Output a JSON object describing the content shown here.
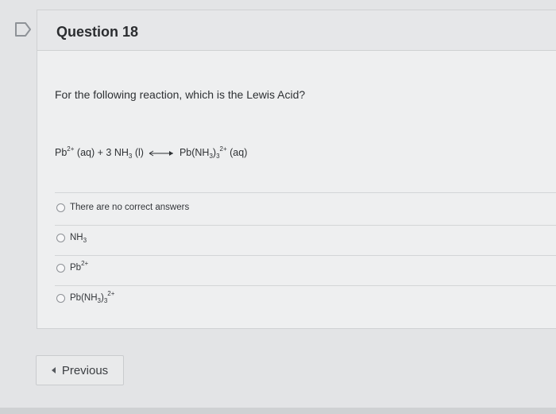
{
  "question": {
    "title": "Question 18",
    "prompt": "For the following reaction, which is the Lewis Acid?"
  },
  "equation": {
    "reactant1": "Pb",
    "reactant1_charge": "2+",
    "reactant1_state": "(aq)",
    "plus": "+",
    "reactant2_coef": "3",
    "reactant2": "NH",
    "reactant2_sub": "3",
    "reactant2_state": "(l)",
    "product_open": "Pb(NH",
    "product_sub_inner": "3",
    "product_close": ")",
    "product_sub_outer": "3",
    "product_charge": "2+",
    "product_state": "(aq)"
  },
  "options": [
    {
      "text": "There are no correct answers"
    },
    {
      "base": "NH",
      "sub": "3"
    },
    {
      "base": "Pb",
      "sup": "2+"
    },
    {
      "open": "Pb(NH",
      "sub_inner": "3",
      "close": ")",
      "sub_outer": "3",
      "sup": "2+"
    }
  ],
  "nav": {
    "previous_label": "Previous"
  },
  "icons": {
    "flag": "flag-icon",
    "previous": "triangle-left-icon"
  }
}
